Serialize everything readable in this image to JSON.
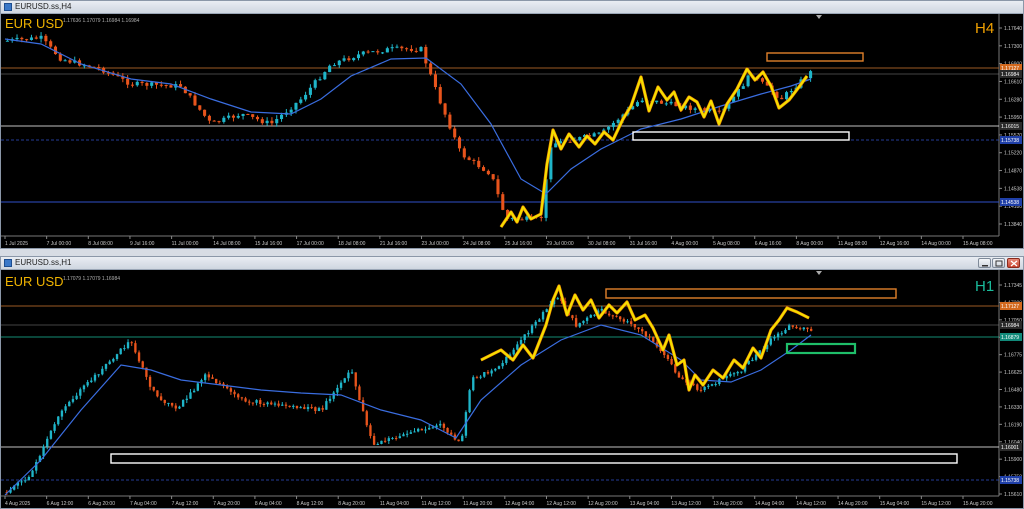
{
  "windows": [
    {
      "id": "h4",
      "title": "EURUSD.ss,H4",
      "symbol": "EUR USD",
      "timeframe": "H4",
      "timeframe_color": "#f0a000",
      "ohlc": "1.17636 1.17079 1.16984 1.16984",
      "price_labels": [
        "1.17640",
        "1.17300",
        "1.16900",
        "1.16610",
        "1.16280",
        "1.15950",
        "1.15570",
        "1.15220",
        "1.14870",
        "1.14538",
        "1.14180",
        "1.13840"
      ],
      "highlight_prices": [
        {
          "text": "1.17127",
          "color": "#d2691e"
        },
        {
          "text": "1.16984",
          "color": "#2a2a2a"
        },
        {
          "text": "1.16015",
          "color": "#2a2a2a"
        },
        {
          "text": "1.15738",
          "color": "#1f3fa8"
        },
        {
          "text": "1.14538",
          "color": "#1f3fa8"
        }
      ],
      "time_labels": [
        "1 Jul 2025",
        "7 Jul 00:00",
        "8 Jul 08:00",
        "9 Jul 16:00",
        "11 Jul 00:00",
        "14 Jul 08:00",
        "15 Jul 16:00",
        "17 Jul 00:00",
        "18 Jul 08:00",
        "21 Jul 16:00",
        "23 Jul 00:00",
        "24 Jul 08:00",
        "25 Jul 16:00",
        "29 Jul 00:00",
        "30 Jul 08:00",
        "31 Jul 16:00",
        "4 Aug 00:00",
        "5 Aug 08:00",
        "6 Aug 16:00",
        "8 Aug 00:00",
        "11 Aug 08:00",
        "12 Aug 16:00",
        "14 Aug 00:00",
        "15 Aug 08:00"
      ]
    },
    {
      "id": "h1",
      "title": "EURUSD.ss,H1",
      "symbol": "EUR USD",
      "timeframe": "H1",
      "timeframe_color": "#1abc9c",
      "ohlc": "1.17079 1.17079 1.16984",
      "price_labels": [
        "1.17345",
        "1.17200",
        "1.17050",
        "1.16900",
        "1.16775",
        "1.16625",
        "1.16480",
        "1.16330",
        "1.16190",
        "1.16040",
        "1.15900",
        "1.15750",
        "1.15610"
      ],
      "highlight_prices": [
        {
          "text": "1.17127",
          "color": "#d2691e"
        },
        {
          "text": "1.16984",
          "color": "#2a2a2a"
        },
        {
          "text": "1.16879",
          "color": "#118a7a"
        },
        {
          "text": "1.16001",
          "color": "#2a2a2a"
        },
        {
          "text": "1.15738",
          "color": "#1f3fa8"
        }
      ],
      "time_labels": [
        "4 Aug 2025",
        "6 Aug 12:00",
        "6 Aug 20:00",
        "7 Aug 04:00",
        "7 Aug 12:00",
        "7 Aug 20:00",
        "8 Aug 04:00",
        "8 Aug 12:00",
        "8 Aug 20:00",
        "11 Aug 04:00",
        "11 Aug 12:00",
        "11 Aug 20:00",
        "12 Aug 04:00",
        "12 Aug 12:00",
        "12 Aug 20:00",
        "13 Aug 04:00",
        "13 Aug 12:00",
        "13 Aug 20:00",
        "14 Aug 04:00",
        "14 Aug 12:00",
        "14 Aug 20:00",
        "15 Aug 04:00",
        "15 Aug 12:00",
        "15 Aug 20:00"
      ]
    }
  ],
  "colors": {
    "bull": "#1fb5c9",
    "bear": "#e8541c",
    "ma": "#3a6de0",
    "zigzag": "#f5e000",
    "zigzag_accent": "#f08c00",
    "level_white": "#ffffff",
    "level_orange": "#e0802a",
    "level_blue": "#3050c8",
    "zone_orange": "#e0802a",
    "zone_white": "#ffffff",
    "zone_green": "#1fbf6a"
  }
}
